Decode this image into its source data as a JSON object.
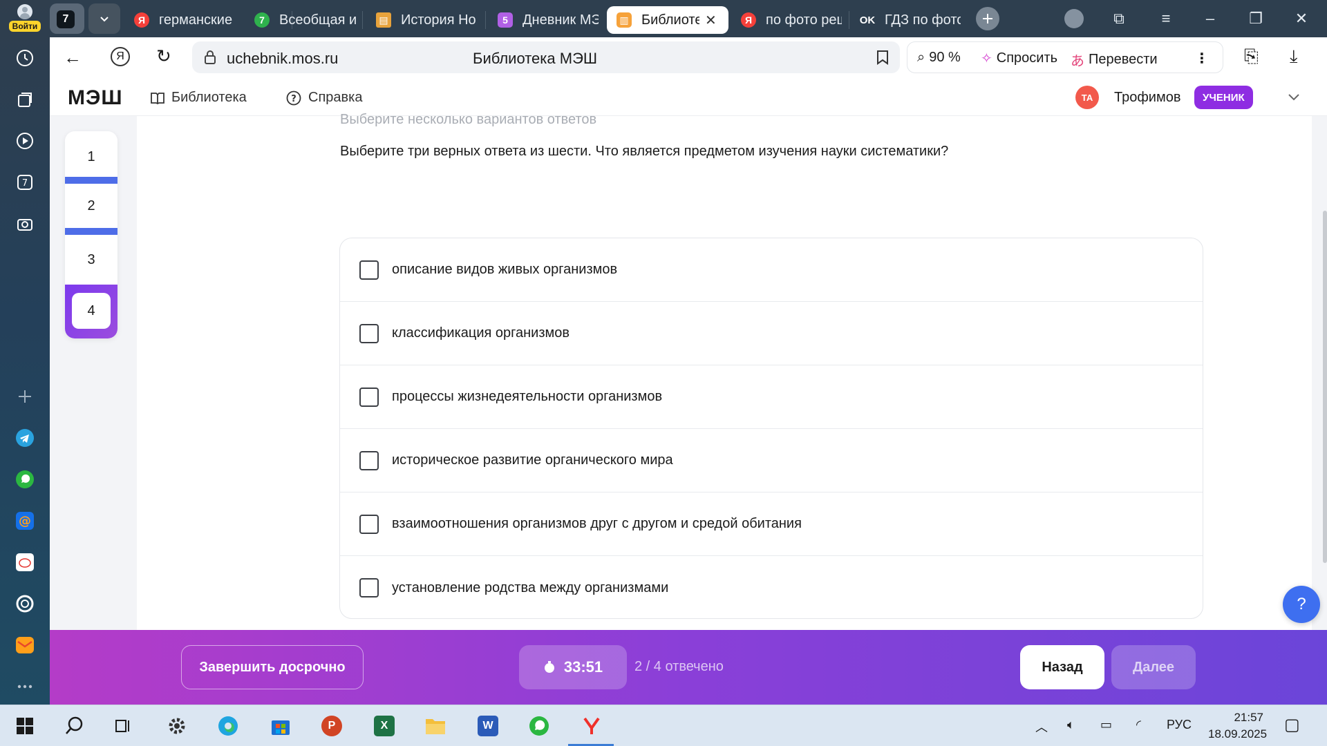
{
  "sidebar": {
    "login_label": "Войти",
    "items": [
      "history-icon",
      "collections-icon",
      "video-icon",
      "seven-icon",
      "camera-icon",
      "add-icon",
      "telegram-icon",
      "whatsapp-icon",
      "mail-icon",
      "gosuslugi-icon",
      "alice-icon",
      "yandex-mail-icon",
      "more-icon"
    ]
  },
  "tabs": [
    {
      "title": "германские",
      "favicon": "Я",
      "color": "#f5403a"
    },
    {
      "title": "Всеобщая и",
      "favicon": "7",
      "color": "#2fb24d"
    },
    {
      "title": "История Но",
      "favicon": "book",
      "color": "#e8a33c"
    },
    {
      "title": "Дневник МЭ",
      "favicon": "5",
      "color": "#b160e6"
    },
    {
      "title": "Библиотека",
      "favicon": "lib",
      "color": "#f6a23a",
      "active": true
    },
    {
      "title": "по фото реш",
      "favicon": "Я",
      "color": "#f5403a"
    },
    {
      "title": "ГДЗ по фото",
      "favicon": "ок",
      "color": "#2e3f4f"
    }
  ],
  "tab_counter": "7",
  "address": {
    "url": "uchebnik.mos.ru",
    "page_title": "Библиотека МЭШ",
    "zoom": "90 %",
    "ask_label": "Спросить",
    "translate_label": "Перевести"
  },
  "site": {
    "logo": "МЭШ",
    "nav": [
      {
        "label": "Библиотека"
      },
      {
        "label": "Справка"
      }
    ],
    "user_initials": "ТА",
    "user_name": "Трофимов",
    "role": "УЧЕНИК"
  },
  "quiz": {
    "numbers": [
      "1",
      "2",
      "3",
      "4"
    ],
    "current": "4",
    "hint": "Выберите несколько вариантов ответов",
    "question": "Выберите три верных ответа из шести. Что является предметом изучения науки систематики?",
    "options": [
      "описание видов живых организмов",
      "классификация организмов",
      "процессы жизнедеятельности организмов",
      "историческое развитие органического мира",
      "взаимоотношения организмов друг с другом и средой обитания",
      "установление родства между организмами"
    ]
  },
  "footer": {
    "finish_label": "Завершить досрочно",
    "timer": "33:51",
    "answered": "2 / 4 отвечено",
    "back_label": "Назад",
    "next_label": "Далее",
    "help_label": "?"
  },
  "taskbar": {
    "lang": "РУС",
    "time": "21:57",
    "date": "18.09.2025"
  }
}
